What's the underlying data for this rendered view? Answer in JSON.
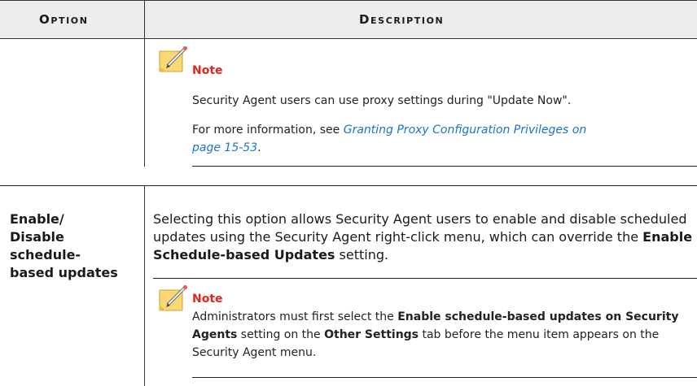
{
  "header": {
    "option": "Option",
    "description": "Description"
  },
  "note1": {
    "title": "Note",
    "line1": "Security Agent users can use proxy settings during \"Update Now\".",
    "more_prefix": "For more information, see ",
    "link_line1": "Granting Proxy Configuration Privileges on",
    "link_line2": "page 15-53",
    "more_suffix": "."
  },
  "row2": {
    "option_lines": [
      "Enable/",
      "Disable",
      "schedule-",
      "based updates"
    ],
    "desc_part1": "Selecting this option allows Security Agent users to enable and disable scheduled updates using the Security Agent right-click menu, which can override the ",
    "desc_bold": "Enable Schedule-based Updates",
    "desc_part2": " setting."
  },
  "note2": {
    "title": "Note",
    "t1": "Administrators must first select the ",
    "b1": "Enable schedule-based updates on Security Agents",
    "t2": " setting on the ",
    "b2": "Other Settings",
    "t3": " tab before the menu item appears on the Security Agent menu."
  }
}
